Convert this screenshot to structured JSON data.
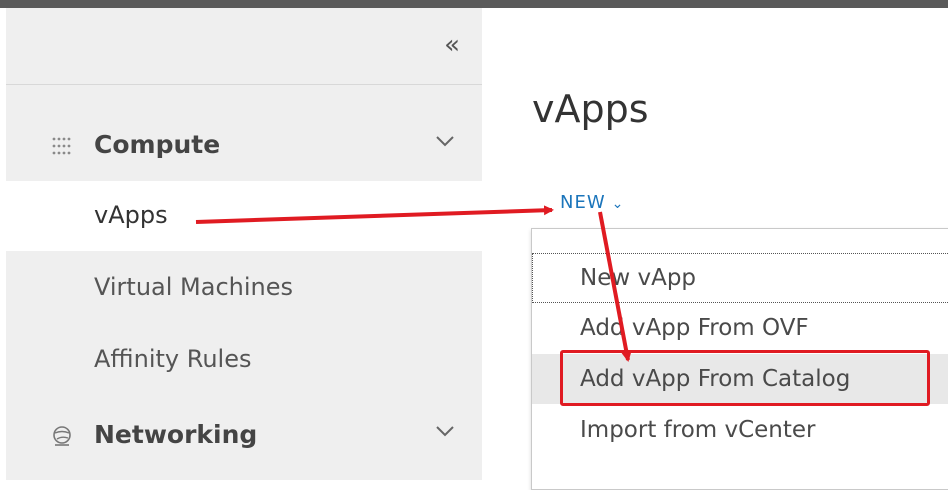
{
  "sidebar": {
    "collapse_glyph": "«",
    "compute": {
      "label": "Compute",
      "icon": "grid-dots-icon"
    },
    "items": [
      {
        "label": "vApps",
        "active": true
      },
      {
        "label": "Virtual Machines",
        "active": false
      },
      {
        "label": "Affinity Rules",
        "active": false
      }
    ],
    "networking": {
      "label": "Networking",
      "icon": "globe-icon"
    }
  },
  "main": {
    "title": "vApps",
    "new_button": {
      "label": "NEW",
      "caret": "⌄"
    },
    "dropdown": [
      {
        "label": "New vApp",
        "state": "focused"
      },
      {
        "label": "Add vApp From OVF",
        "state": "normal"
      },
      {
        "label": "Add vApp From Catalog",
        "state": "hover"
      },
      {
        "label": "Import from vCenter",
        "state": "normal"
      }
    ]
  },
  "colors": {
    "accent_blue": "#1b75bb",
    "annotation_red": "#e01b22",
    "sidebar_bg": "#efefef"
  }
}
